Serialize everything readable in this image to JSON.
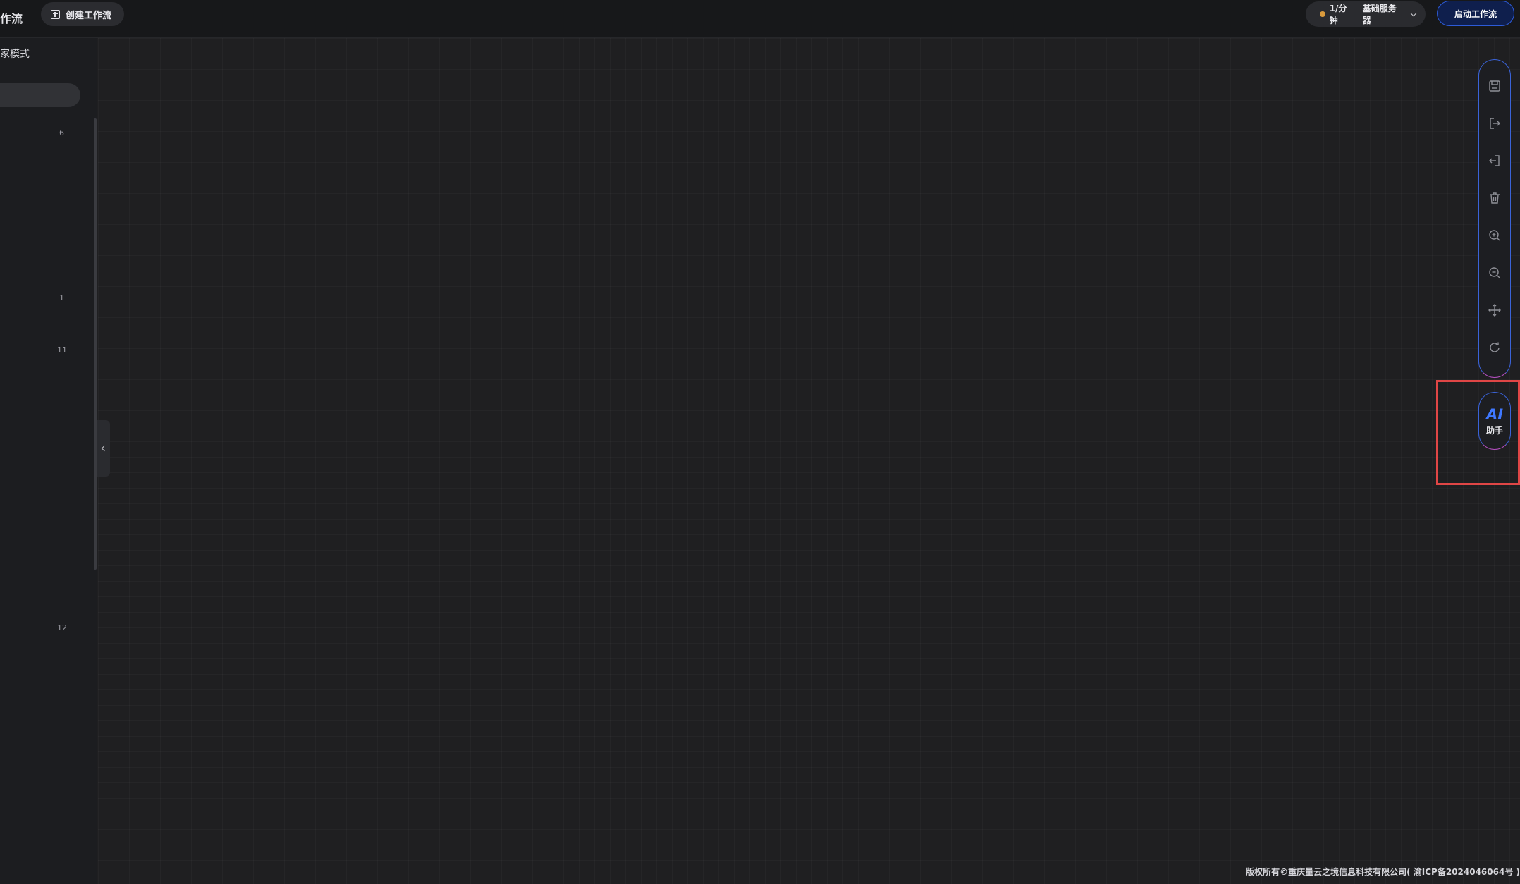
{
  "header": {
    "app_title": "作流",
    "create_button_label": "创建工作流",
    "server_select": {
      "rate": "1/分钟",
      "server_name": "基础服务器"
    },
    "launch_button_label": "启动工作流"
  },
  "sidebar": {
    "mode_label": "家模式",
    "counts": [
      "6",
      "1",
      "11",
      "12"
    ]
  },
  "toolbar": {
    "tools": [
      {
        "icon": "save-icon"
      },
      {
        "icon": "export-icon"
      },
      {
        "icon": "import-icon"
      },
      {
        "icon": "delete-icon"
      },
      {
        "icon": "zoom-in-icon"
      },
      {
        "icon": "zoom-out-icon"
      },
      {
        "icon": "fit-view-icon"
      },
      {
        "icon": "refresh-icon"
      }
    ]
  },
  "ai_assistant": {
    "title": "AI",
    "subtitle": "助手"
  },
  "footer": {
    "copyright": "版权所有©重庆量云之境信息科技有限公司( 渝ICP备2024046064号 )"
  },
  "colors": {
    "accent_blue": "#3a63d8",
    "accent_purple": "#b54fc2",
    "highlight_red": "#e04646",
    "background": "#1f1f21"
  }
}
